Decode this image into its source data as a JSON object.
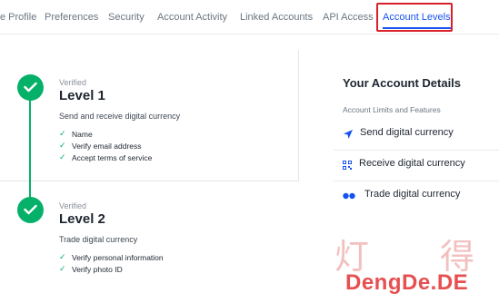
{
  "tabs": [
    {
      "label": "e Profile"
    },
    {
      "label": "Preferences"
    },
    {
      "label": "Security"
    },
    {
      "label": "Account Activity"
    },
    {
      "label": "Linked Accounts"
    },
    {
      "label": "API Access"
    },
    {
      "label": "Account Levels",
      "active": true
    }
  ],
  "levels": [
    {
      "status": "Verified",
      "title": "Level 1",
      "description": "Send and receive digital currency",
      "requirements": [
        "Name",
        "Verify email address",
        "Accept terms of service"
      ]
    },
    {
      "status": "Verified",
      "title": "Level 2",
      "description": "Trade digital currency",
      "requirements": [
        "Verify personal information",
        "Verify photo ID"
      ]
    }
  ],
  "details": {
    "title": "Your Account Details",
    "subtitle": "Account Limits and Features",
    "features": [
      {
        "label": "Send digital currency",
        "icon": "send-arrow-icon"
      },
      {
        "label": "Receive digital currency",
        "icon": "qr-code-icon"
      },
      {
        "label": "Trade digital currency",
        "icon": "trade-dots-icon"
      }
    ]
  },
  "watermark": {
    "chars": [
      "灯",
      "得"
    ],
    "text": "DengDe.DE"
  },
  "colors": {
    "accent": "#1652f0",
    "verified_green": "#05b169",
    "highlight_red": "#d8202a"
  }
}
